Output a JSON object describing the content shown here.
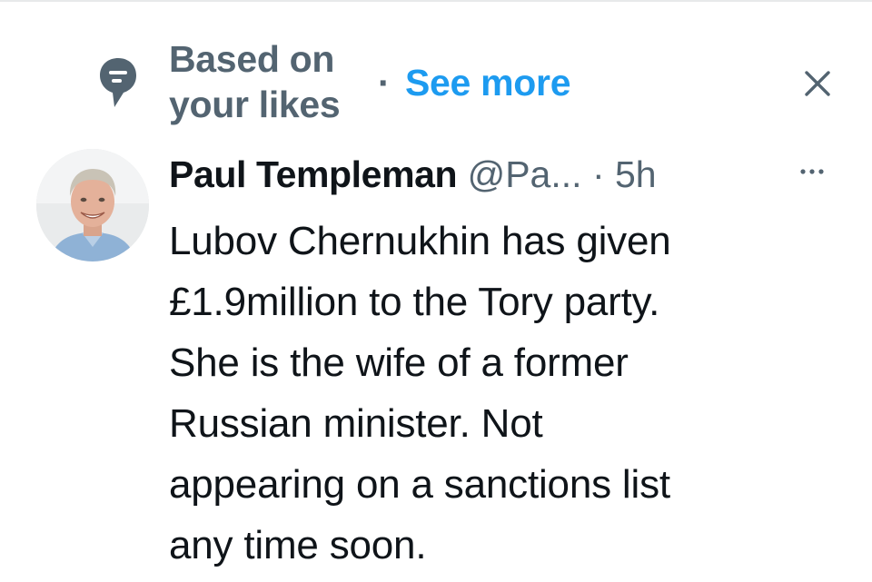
{
  "context": {
    "label_line1": "Based on",
    "label_line2": "your likes",
    "separator": "·",
    "see_more": "See more",
    "icon": "speech-bubble-icon",
    "dismiss_icon": "close-icon"
  },
  "tweet": {
    "author_name": "Paul Templeman",
    "author_handle": "@Pa...",
    "separator": " · ",
    "timestamp": "5h",
    "more_icon": "more-dots-icon",
    "avatar": "author-avatar",
    "body_lines": [
      "Lubov Chernukhin has given",
      "£1.9million to the Tory party.",
      "She is the wife of a former",
      "Russian minister. Not",
      "appearing on a sanctions list",
      "any time soon."
    ]
  },
  "colors": {
    "text_primary": "#0f1419",
    "text_secondary": "#536471",
    "link": "#1d9bf0",
    "background": "#ffffff"
  }
}
